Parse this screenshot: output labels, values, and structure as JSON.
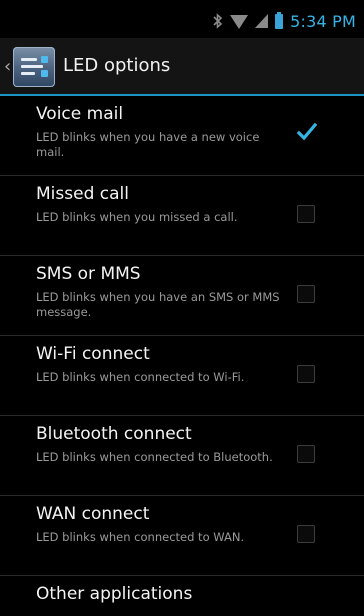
{
  "status_bar": {
    "time": "5:34 PM",
    "icons": [
      "bluetooth-icon",
      "wifi-icon",
      "signal-icon",
      "battery-icon"
    ],
    "accent_color": "#33b5e5"
  },
  "action_bar": {
    "title": "LED options",
    "icon": "led-settings-icon"
  },
  "items": [
    {
      "title": "Voice mail",
      "summary": "LED blinks when you have a new voice mail.",
      "checked": true
    },
    {
      "title": "Missed call",
      "summary": "LED blinks when you missed a call.",
      "checked": false
    },
    {
      "title": "SMS or MMS",
      "summary": "LED blinks when you have an SMS or MMS message.",
      "checked": false
    },
    {
      "title": "Wi-Fi connect",
      "summary": "LED blinks when connected to Wi-Fi.",
      "checked": false
    },
    {
      "title": "Bluetooth connect",
      "summary": "LED blinks when connected to Bluetooth.",
      "checked": false
    },
    {
      "title": "WAN connect",
      "summary": "LED blinks when connected to WAN.",
      "checked": false
    },
    {
      "title": "Other applications"
    }
  ]
}
